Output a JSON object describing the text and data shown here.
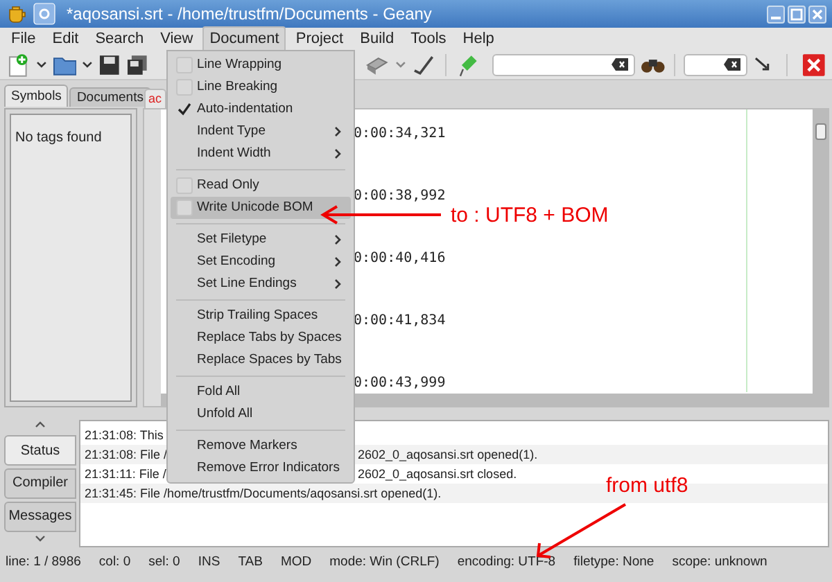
{
  "window": {
    "title": "*aqosansi.srt - /home/trustfm/Documents - Geany"
  },
  "menu_bar": [
    {
      "label": "File",
      "selected": false
    },
    {
      "label": "Edit",
      "selected": false
    },
    {
      "label": "Search",
      "selected": false
    },
    {
      "label": "View",
      "selected": false
    },
    {
      "label": "Document",
      "selected": true
    },
    {
      "label": "Project",
      "selected": false
    },
    {
      "label": "Build",
      "selected": false
    },
    {
      "label": "Tools",
      "selected": false
    },
    {
      "label": "Help",
      "selected": false
    }
  ],
  "sidebar": {
    "tabs": [
      {
        "label": "Symbols",
        "selected": true
      },
      {
        "label": "Documents",
        "selected": false
      }
    ],
    "empty_text": "No tags found"
  },
  "editor": {
    "tab_label": "ac",
    "lines": [
      "0:00:34,321",
      "0:00:38,992",
      "0:00:40,416",
      "0:00:41,834",
      "0:00:43,999"
    ]
  },
  "document_menu": [
    {
      "kind": "check",
      "label": "Line Wrapping",
      "checked": false,
      "selected": false
    },
    {
      "kind": "check",
      "label": "Line Breaking",
      "checked": false,
      "selected": false
    },
    {
      "kind": "check",
      "label": "Auto-indentation",
      "checked": true,
      "selected": false
    },
    {
      "kind": "submenu",
      "label": "Indent Type",
      "selected": false
    },
    {
      "kind": "submenu",
      "label": "Indent Width",
      "selected": false
    },
    {
      "kind": "separator"
    },
    {
      "kind": "check",
      "label": "Read Only",
      "checked": false,
      "selected": false
    },
    {
      "kind": "check",
      "label": "Write Unicode BOM",
      "checked": false,
      "selected": true
    },
    {
      "kind": "separator"
    },
    {
      "kind": "submenu",
      "label": "Set Filetype",
      "selected": false
    },
    {
      "kind": "submenu",
      "label": "Set Encoding",
      "selected": false
    },
    {
      "kind": "submenu",
      "label": "Set Line Endings",
      "selected": false
    },
    {
      "kind": "separator"
    },
    {
      "kind": "plain",
      "label": "Strip Trailing Spaces",
      "selected": false
    },
    {
      "kind": "plain",
      "label": "Replace Tabs by Spaces",
      "selected": false
    },
    {
      "kind": "plain",
      "label": "Replace Spaces by Tabs",
      "selected": false
    },
    {
      "kind": "separator"
    },
    {
      "kind": "plain",
      "label": "Fold All",
      "selected": false
    },
    {
      "kind": "plain",
      "label": "Unfold All",
      "selected": false
    },
    {
      "kind": "separator"
    },
    {
      "kind": "plain",
      "label": "Remove Markers",
      "selected": false
    },
    {
      "kind": "plain",
      "label": "Remove Error Indicators",
      "selected": false
    }
  ],
  "message_tabs": [
    {
      "label": "Status",
      "selected": true
    },
    {
      "label": "Compiler",
      "selected": false
    },
    {
      "label": "Messages",
      "selected": false
    }
  ],
  "messages": [
    {
      "start": "21:31:08: This"
    },
    {
      "start": "21:31:08: File /",
      "end": "2602_0_aqosansi.srt opened(1)."
    },
    {
      "start": "21:31:11: File /",
      "end": "2602_0_aqosansi.srt closed."
    },
    {
      "start": "21:31:45: File /home/trustfm/Documents/aqosansi.srt opened(1)."
    }
  ],
  "status_bar": [
    "line: 1 / 8986",
    "col: 0",
    "sel: 0",
    "INS",
    "TAB",
    "MOD",
    "mode: Win (CRLF)",
    "encoding: UTF-8",
    "filetype: None",
    "scope: unknown"
  ],
  "annotations": [
    "to : UTF8 + BOM",
    "from utf8"
  ]
}
